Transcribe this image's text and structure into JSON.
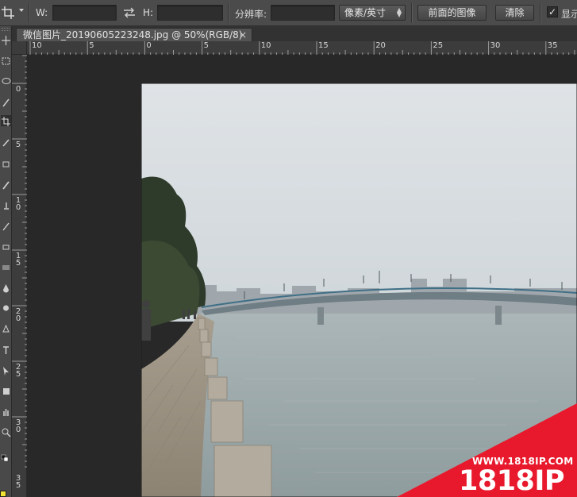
{
  "options_bar": {
    "width_label": "W:",
    "width_value": "",
    "height_label": "H:",
    "height_value": "",
    "resolution_label": "分辨率:",
    "resolution_value": "",
    "unit_select": "像素/英寸",
    "front_image_button": "前面的图像",
    "clear_button": "清除",
    "show_label": "显示"
  },
  "document_tab": {
    "title": "微信图片_20190605223248.jpg @ 50%(RGB/8)",
    "close_glyph": "×"
  },
  "rulers": {
    "horizontal_labels": [
      "10",
      "5",
      "0",
      "5",
      "10",
      "15",
      "20",
      "25",
      "30",
      "35"
    ],
    "vertical_labels": [
      "0",
      "5",
      "10",
      "15",
      "20",
      "25",
      "30",
      "35"
    ]
  },
  "toolbox": {
    "foreground_color": "#f2e234"
  },
  "watermark": {
    "url": "WWW.1818IP.COM",
    "brand": "1818IP",
    "color": "#e8192c"
  },
  "colors": {
    "options_bar_bg": "#4b4b4b",
    "canvas_bg": "#282828",
    "ruler_bg": "#3c3c3c"
  }
}
